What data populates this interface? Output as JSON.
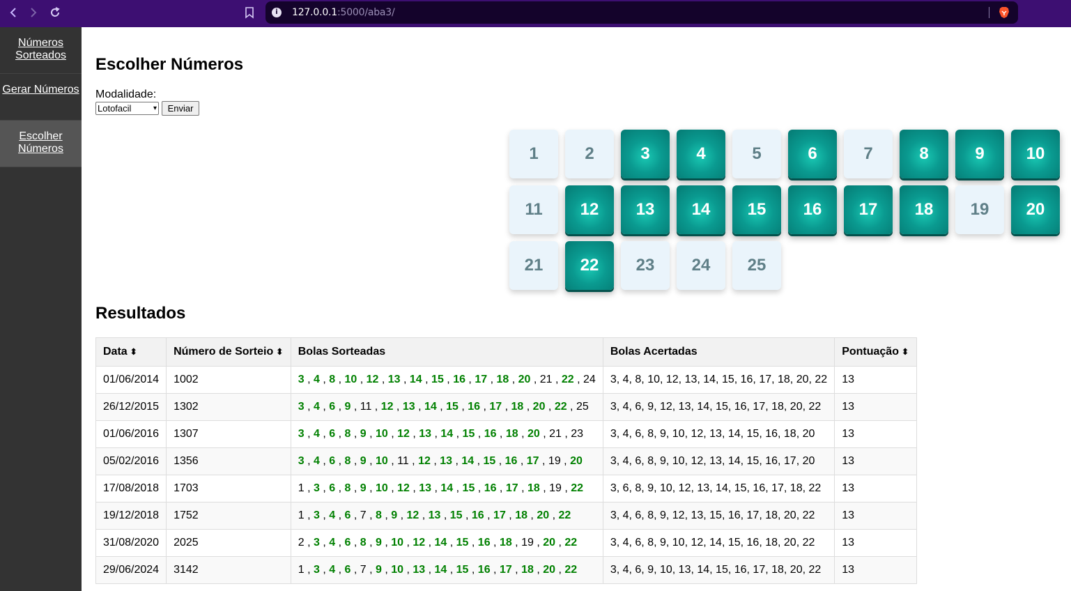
{
  "browser": {
    "url_host": "127.0.0.1",
    "url_rest": ":5000/aba3/"
  },
  "sidebar": {
    "items": [
      {
        "label": "Números Sorteados",
        "active": false
      },
      {
        "label": "Gerar Números",
        "active": false
      },
      {
        "label": "Escolher Números",
        "active": true
      }
    ]
  },
  "form": {
    "title": "Escolher Números",
    "modality_label": "Modalidade:",
    "modality_value": "Lotofacil",
    "submit_label": "Enviar"
  },
  "numbers": {
    "all": [
      1,
      2,
      3,
      4,
      5,
      6,
      7,
      8,
      9,
      10,
      11,
      12,
      13,
      14,
      15,
      16,
      17,
      18,
      19,
      20,
      21,
      22,
      23,
      24,
      25
    ],
    "selected": [
      3,
      4,
      6,
      8,
      9,
      10,
      12,
      13,
      14,
      15,
      16,
      17,
      18,
      20,
      22
    ]
  },
  "results": {
    "title": "Resultados",
    "columns": [
      "Data",
      "Número de Sorteio",
      "Bolas Sorteadas",
      "Bolas Acertadas",
      "Pontuação"
    ],
    "sortable": [
      true,
      true,
      false,
      false,
      true
    ],
    "sort_icon": "⬍",
    "rows": [
      {
        "date": "01/06/2014",
        "draw": "1002",
        "balls": [
          3,
          4,
          8,
          10,
          12,
          13,
          14,
          15,
          16,
          17,
          18,
          20,
          21,
          22,
          24
        ],
        "hits": "3, 4, 8, 10, 12, 13, 14, 15, 16, 17, 18, 20, 22",
        "score": "13"
      },
      {
        "date": "26/12/2015",
        "draw": "1302",
        "balls": [
          3,
          4,
          6,
          9,
          11,
          12,
          13,
          14,
          15,
          16,
          17,
          18,
          20,
          22,
          25
        ],
        "hits": "3, 4, 6, 9, 12, 13, 14, 15, 16, 17, 18, 20, 22",
        "score": "13"
      },
      {
        "date": "01/06/2016",
        "draw": "1307",
        "balls": [
          3,
          4,
          6,
          8,
          9,
          10,
          12,
          13,
          14,
          15,
          16,
          18,
          20,
          21,
          23
        ],
        "hits": "3, 4, 6, 8, 9, 10, 12, 13, 14, 15, 16, 18, 20",
        "score": "13"
      },
      {
        "date": "05/02/2016",
        "draw": "1356",
        "balls": [
          3,
          4,
          6,
          8,
          9,
          10,
          11,
          12,
          13,
          14,
          15,
          16,
          17,
          19,
          20
        ],
        "hits": "3, 4, 6, 8, 9, 10, 12, 13, 14, 15, 16, 17, 20",
        "score": "13"
      },
      {
        "date": "17/08/2018",
        "draw": "1703",
        "balls": [
          1,
          3,
          6,
          8,
          9,
          10,
          12,
          13,
          14,
          15,
          16,
          17,
          18,
          19,
          22
        ],
        "hits": "3, 6, 8, 9, 10, 12, 13, 14, 15, 16, 17, 18, 22",
        "score": "13"
      },
      {
        "date": "19/12/2018",
        "draw": "1752",
        "balls": [
          1,
          3,
          4,
          6,
          7,
          8,
          9,
          12,
          13,
          15,
          16,
          17,
          18,
          20,
          22
        ],
        "hits": "3, 4, 6, 8, 9, 12, 13, 15, 16, 17, 18, 20, 22",
        "score": "13"
      },
      {
        "date": "31/08/2020",
        "draw": "2025",
        "balls": [
          2,
          3,
          4,
          6,
          8,
          9,
          10,
          12,
          14,
          15,
          16,
          18,
          19,
          20,
          22
        ],
        "hits": "3, 4, 6, 8, 9, 10, 12, 14, 15, 16, 18, 20, 22",
        "score": "13"
      },
      {
        "date": "29/06/2024",
        "draw": "3142",
        "balls": [
          1,
          3,
          4,
          6,
          7,
          9,
          10,
          13,
          14,
          15,
          16,
          17,
          18,
          20,
          22
        ],
        "hits": "3, 4, 6, 9, 10, 13, 14, 15, 16, 17, 18, 20, 22",
        "score": "13"
      }
    ]
  },
  "colors": {
    "chrome": "#3d0f72",
    "sidebar": "#333333",
    "selected_ball": "#0a9a90",
    "unselected_ball": "#eaf4fb",
    "hit_text": "#008000"
  },
  "icons": {
    "back": "chevron-left-icon",
    "forward": "chevron-right-icon",
    "reload": "reload-icon",
    "bookmark": "bookmark-icon",
    "site_info": "info-icon",
    "brave": "brave-lion-icon",
    "select_arrow": "chevron-down-icon",
    "sort": "sort-arrows-icon"
  }
}
